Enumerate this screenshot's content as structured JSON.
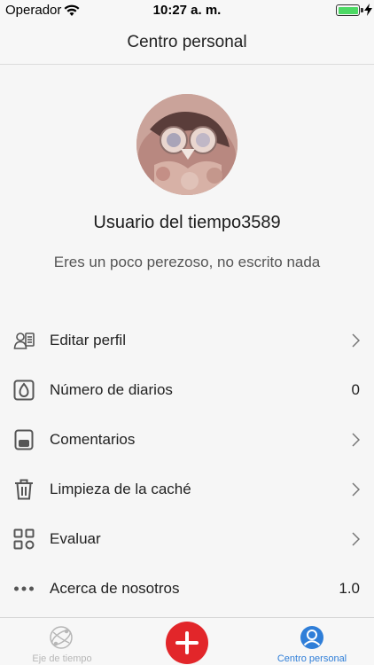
{
  "status_bar": {
    "carrier": "Operador",
    "time": "10:27 a. m."
  },
  "nav": {
    "title": "Centro personal"
  },
  "profile": {
    "username": "Usuario del tiempo3589",
    "bio": "Eres un poco perezoso, no escrito nada"
  },
  "menu": [
    {
      "label": "Editar perfil",
      "value": "",
      "icon": "profile-card-icon"
    },
    {
      "label": "Número de diarios",
      "value": "0",
      "icon": "diary-count-icon"
    },
    {
      "label": "Comentarios",
      "value": "",
      "icon": "comment-icon"
    },
    {
      "label": "Limpieza de la caché",
      "value": "",
      "icon": "trash-icon"
    },
    {
      "label": "Evaluar",
      "value": "",
      "icon": "grid-icon"
    },
    {
      "label": "Acerca de nosotros",
      "value": "1.0",
      "icon": "more-dots-icon"
    }
  ],
  "tabs": {
    "timeline": "Eje de tiempo",
    "personal": "Centro personal"
  },
  "colors": {
    "accent": "#2f7ed8",
    "add_button": "#e2262a",
    "tab_inactive": "#b7b7b7"
  }
}
